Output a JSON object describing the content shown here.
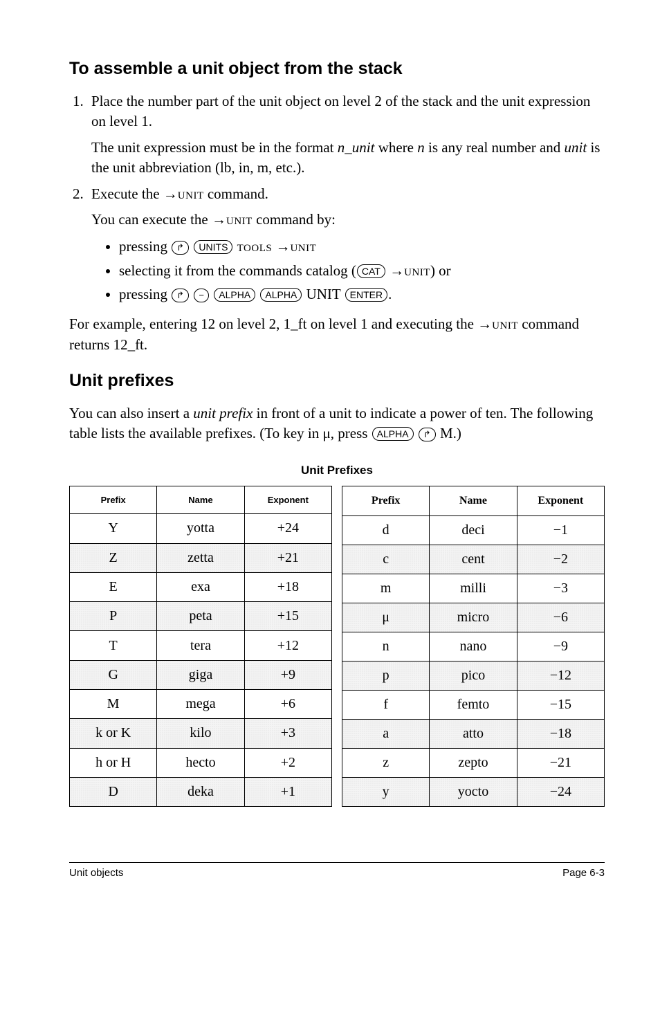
{
  "heading1": "To assemble a unit object from the stack",
  "step1_a": "Place the number part of the unit object on level 2 of the stack and the unit expression on level 1.",
  "step1_b_before": "The unit expression must be in the format ",
  "step1_b_n": "n",
  "step1_b_underscore": "_",
  "step1_b_unit": "unit",
  "step1_b_mid": " where ",
  "step1_b_n2": "n",
  "step1_b_after": " is any real number and ",
  "step1_b_unit2": "unit",
  "step1_b_end": " is the unit abbreviation (lb, in, m, etc.).",
  "step2_label": "Execute the →",
  "step2_unit": "unit",
  "step2_label_end": " command.",
  "step2_sub_a": "You can execute the →",
  "step2_sub_unit": "unit",
  "step2_sub_end": " command by:",
  "bullet1_a": "pressing ",
  "key_shift": "↱",
  "key_units": "UNITS",
  "bullet1_b": " ",
  "tools": "tools",
  "bullet1_c": " →",
  "bullet1_unit": "unit",
  "bullet2_a": "selecting it from the commands catalog (",
  "key_cat": "CAT",
  "bullet2_b": " →",
  "bullet2_unit": "unit",
  "bullet2_c": ") or",
  "bullet3_a": "pressing ",
  "key_minus": "−",
  "key_alpha": "ALPHA",
  "bullet3_unit": "UNIT",
  "key_enter": "ENTER",
  "bullet3_end": ".",
  "example_a": "For example, entering 12 on level 2, 1_ft on level 1 and executing the →",
  "example_unit": "unit",
  "example_b": " command returns 12_ft.",
  "heading2": "Unit prefixes",
  "para2_a": "You can also insert a ",
  "para2_prefix": "unit prefix",
  "para2_b": " in front of a unit to indicate a power of ten. The following table lists the available prefixes. (To key in μ, press ",
  "para2_m": " M.)",
  "table_caption": "Unit Prefixes",
  "th_left": {
    "prefix": "Prefix",
    "name": "Name",
    "exponent": "Exponent"
  },
  "th_right": {
    "prefix": "Prefix",
    "name": "Name",
    "exponent": "Exponent"
  },
  "left": [
    {
      "p": "Y",
      "n": "yotta",
      "e": "+24"
    },
    {
      "p": "Z",
      "n": "zetta",
      "e": "+21"
    },
    {
      "p": "E",
      "n": "exa",
      "e": "+18"
    },
    {
      "p": "P",
      "n": "peta",
      "e": "+15"
    },
    {
      "p": "T",
      "n": "tera",
      "e": "+12"
    },
    {
      "p": "G",
      "n": "giga",
      "e": "+9"
    },
    {
      "p": "M",
      "n": "mega",
      "e": "+6"
    },
    {
      "p": "k or K",
      "n": "kilo",
      "e": "+3"
    },
    {
      "p": "h or H",
      "n": "hecto",
      "e": "+2"
    },
    {
      "p": "D",
      "n": "deka",
      "e": "+1"
    }
  ],
  "right": [
    {
      "p": "d",
      "n": "deci",
      "e": "−1"
    },
    {
      "p": "c",
      "n": "cent",
      "e": "−2"
    },
    {
      "p": "m",
      "n": "milli",
      "e": "−3"
    },
    {
      "p": "μ",
      "n": "micro",
      "e": "−6"
    },
    {
      "p": "n",
      "n": "nano",
      "e": "−9"
    },
    {
      "p": "p",
      "n": "pico",
      "e": "−12"
    },
    {
      "p": "f",
      "n": "femto",
      "e": "−15"
    },
    {
      "p": "a",
      "n": "atto",
      "e": "−18"
    },
    {
      "p": "z",
      "n": "zepto",
      "e": "−21"
    },
    {
      "p": "y",
      "n": "yocto",
      "e": "−24"
    }
  ],
  "footer_left": "Unit objects",
  "footer_right": "Page 6-3"
}
